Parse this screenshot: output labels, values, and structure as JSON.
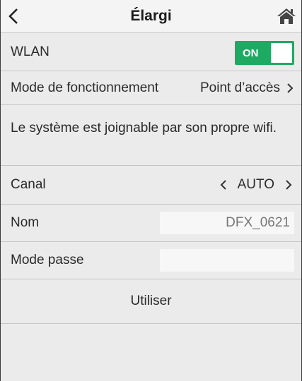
{
  "header": {
    "title": "Élargi"
  },
  "wlan": {
    "label": "WLAN",
    "toggle_label": "ON"
  },
  "mode": {
    "label": "Mode de fonctionnement",
    "value": "Point d’accès"
  },
  "info": {
    "text": "Le système est joignable par son propre wifi."
  },
  "canal": {
    "label": "Canal",
    "value": "AUTO"
  },
  "nom": {
    "label": "Nom",
    "value": "DFX_0621"
  },
  "passe": {
    "label": "Mode passe",
    "value": ""
  },
  "action": {
    "label": "Utiliser"
  },
  "colors": {
    "accent": "#1faa63",
    "background": "#ebebeb"
  },
  "icons": {
    "back": "chevron-left-icon",
    "home": "home-icon",
    "next": "chevron-right-icon"
  }
}
